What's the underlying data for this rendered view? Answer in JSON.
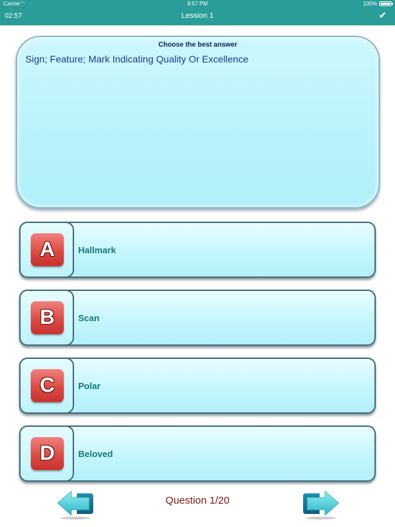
{
  "status_bar": {
    "carrier": "Carrier",
    "time": "9:57 PM",
    "battery": "100%"
  },
  "nav": {
    "timer": "02:57",
    "title": "Lession 1",
    "check_icon": "checkmark-icon"
  },
  "question": {
    "header": "Choose the best answer",
    "text": "Sign; Feature; Mark Indicating Quality Or Excellence"
  },
  "answers": [
    {
      "letter": "A",
      "label": "Hallmark"
    },
    {
      "letter": "B",
      "label": "Scan"
    },
    {
      "letter": "C",
      "label": "Polar"
    },
    {
      "letter": "D",
      "label": "Beloved"
    }
  ],
  "footer": {
    "counter": "Question 1/20"
  },
  "colors": {
    "nav_bar": "#2a9d98",
    "card_fill": "#bff3fb",
    "letter_badge": "#d94842",
    "answer_text": "#137a7d",
    "counter_text": "#7a1818"
  }
}
